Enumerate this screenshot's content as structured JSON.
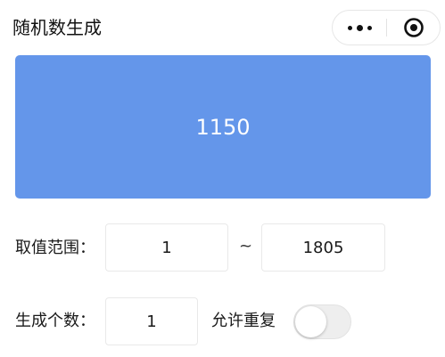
{
  "nav": {
    "title": "随机数生成"
  },
  "capsule": {
    "more_icon": "more-dots-icon",
    "close_icon": "target-circle-icon"
  },
  "result": {
    "value": "1150",
    "background_color": "#6496ea"
  },
  "range": {
    "label": "取值范围：",
    "min_value": "1",
    "separator": "~",
    "max_value": "1805"
  },
  "count": {
    "label": "生成个数：",
    "value": "1",
    "allow_repeat_label": "允许重复",
    "allow_repeat_enabled": false
  }
}
